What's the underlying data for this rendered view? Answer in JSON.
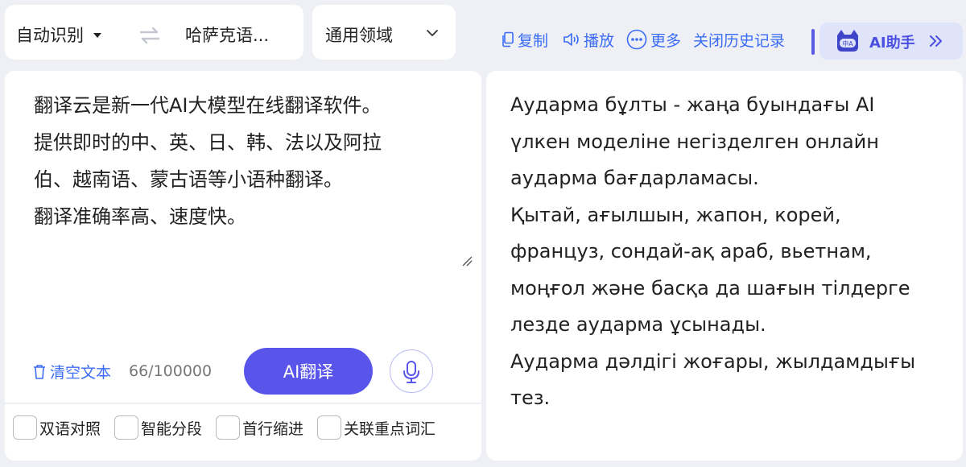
{
  "lang_bar": {
    "source_lang": "自动识别",
    "target_lang": "哈萨克语..."
  },
  "domain_bar": {
    "label": "通用领域"
  },
  "toolbar": {
    "copy": "复制",
    "play": "播放",
    "more": "更多",
    "history": "关闭历史记录",
    "ai_helper": "AI助手",
    "ai_logo_text": "中A"
  },
  "source": {
    "text": "翻译云是新一代AI大模型在线翻译软件。\n提供即时的中、英、日、韩、法以及阿拉\n伯、越南语、蒙古语等小语种翻译。\n翻译准确率高、速度快。",
    "clear_label": "清空文本",
    "char_count": "66/100000",
    "translate_button": "AI翻译"
  },
  "options": [
    {
      "label": "双语对照",
      "checked": false
    },
    {
      "label": "智能分段",
      "checked": false
    },
    {
      "label": "首行缩进",
      "checked": false
    },
    {
      "label": "关联重点词汇",
      "checked": false
    }
  ],
  "target": {
    "text": "Аудармa бұлты - жаңа буындағы AI\nүлкен моделіне негізделген онлайн\nаудармa бағдарламасы.\nҚытай, ағылшын, жапон, корей,\nфранцуз, сондай-ақ араб, вьетнам,\nмоңғол және басқа да шағын тілдерге\nлезде аудармa ұсынады.\nАудармa дәлдігі жоғары, жылдамдығы\nтез."
  },
  "colors": {
    "accent": "#3b6cf6",
    "primary_button": "#5a55ea",
    "background": "#eef0f5"
  }
}
